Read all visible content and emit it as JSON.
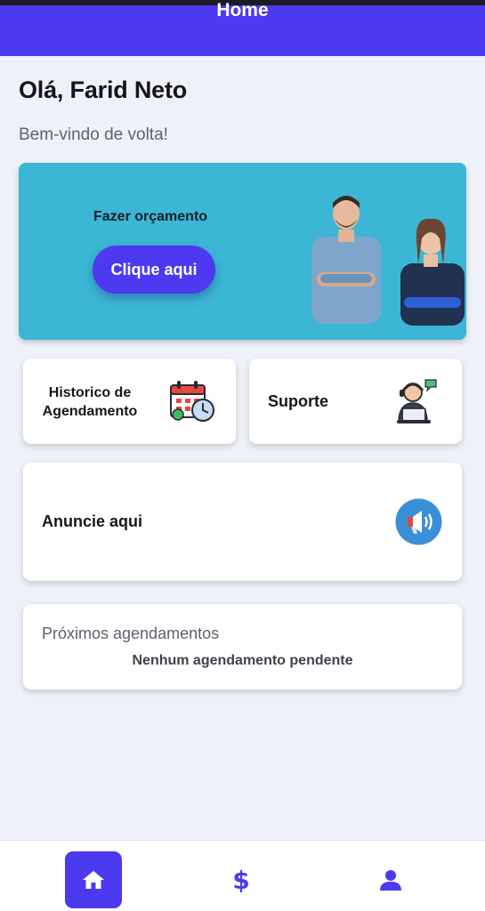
{
  "app_bar": {
    "title": "Home"
  },
  "greeting": "Olá, Farid Neto",
  "welcome": "Bem-vindo de volta!",
  "promo": {
    "label": "Fazer orçamento",
    "button_label": "Clique aqui",
    "background_color": "#3bb6d4",
    "image": "two-professionals-illustration"
  },
  "cards": {
    "history": {
      "label": "Historico de Agendamento",
      "icon": "calendar-clock-icon"
    },
    "support": {
      "label": "Suporte",
      "icon": "support-agent-icon"
    },
    "advertise": {
      "label": "Anuncie aqui",
      "icon": "megaphone-icon"
    }
  },
  "upcoming": {
    "title": "Próximos agendamentos",
    "empty_message": "Nenhum agendamento pendente"
  },
  "bottom_nav": {
    "items": [
      {
        "name": "home",
        "icon": "home-icon",
        "active": true
      },
      {
        "name": "payments",
        "icon": "dollar-icon",
        "active": false
      },
      {
        "name": "profile",
        "icon": "person-icon",
        "active": false
      }
    ]
  },
  "colors": {
    "primary": "#4b3aef",
    "background": "#eef1f8",
    "promo": "#3bb6d4"
  }
}
